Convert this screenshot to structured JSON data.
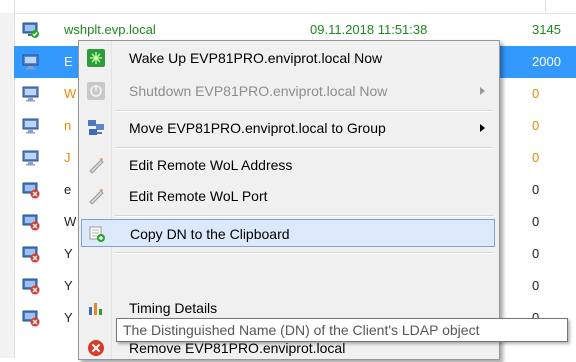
{
  "rows": [
    {
      "name": "wshplt.evp.local",
      "date": "09.11.2018 11:51:38",
      "num": "3145",
      "status": "ok"
    },
    {
      "name": "E",
      "date": "",
      "num": "2000",
      "status": "selected"
    },
    {
      "name": "W",
      "date": "",
      "num": "0",
      "status": "plain"
    },
    {
      "name": "n",
      "date": "",
      "num": "0",
      "status": "plain"
    },
    {
      "name": "J",
      "date": "",
      "num": "0",
      "status": "plain"
    },
    {
      "name": "e",
      "date": "",
      "num": "0",
      "status": "error"
    },
    {
      "name": "W",
      "date": "",
      "num": "0",
      "status": "error"
    },
    {
      "name": "Y",
      "date": "",
      "num": "0",
      "status": "error"
    },
    {
      "name": "Y",
      "date": "",
      "num": "0",
      "status": "error"
    },
    {
      "name": "Y",
      "date": "",
      "num": "0",
      "status": "error"
    }
  ],
  "menu": {
    "items": [
      {
        "label": "Wake Up EVP81PRO.enviprot.local Now",
        "icon": "wake-up-icon",
        "enabled": true,
        "submenu": false
      },
      {
        "label": "Shutdown EVP81PRO.enviprot.local Now",
        "icon": "shutdown-icon",
        "enabled": false,
        "submenu": true
      },
      {
        "label": "Move EVP81PRO.enviprot.local to Group",
        "icon": "move-to-group-icon",
        "enabled": true,
        "submenu": true
      },
      {
        "label": "Edit Remote WoL Address",
        "icon": "edit-icon",
        "enabled": true,
        "submenu": false
      },
      {
        "label": "Edit Remote WoL Port",
        "icon": "edit-icon",
        "enabled": true,
        "submenu": false
      },
      {
        "label": "Copy DN to the Clipboard",
        "icon": "copy-dn-icon",
        "enabled": true,
        "submenu": false,
        "highlighted": true
      },
      {
        "label": "Timing Details",
        "icon": "chart-icon",
        "enabled": true,
        "submenu": false
      },
      {
        "label": "Remove EVP81PRO.enviprot.local",
        "icon": "remove-icon",
        "enabled": true,
        "submenu": false
      }
    ]
  },
  "tooltip": {
    "text": "The Distinguished Name (DN) of the Client's LDAP object"
  },
  "colors": {
    "selection": "#3399ff",
    "online_text": "#1b8a1b",
    "zero_text": "#e58a00",
    "menu_highlight": "#dbe9fb",
    "menu_highlight_border": "#7da2ce"
  }
}
